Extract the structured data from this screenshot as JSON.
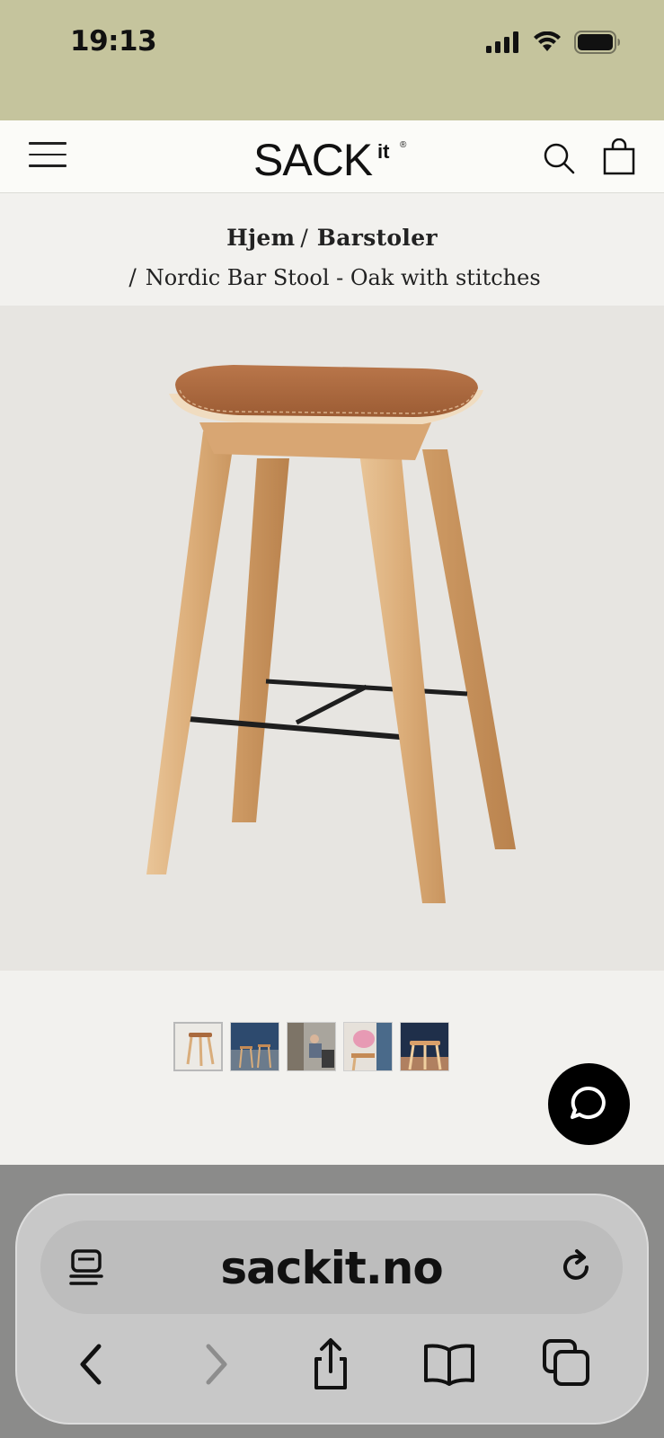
{
  "status_bar": {
    "time": "19:13",
    "icons": [
      "signal-icon",
      "wifi-icon",
      "battery-icon"
    ]
  },
  "header": {
    "logo_text": "SACK",
    "logo_suffix": "it",
    "logo_mark": "®",
    "icons": [
      "menu-icon",
      "search-icon",
      "shopping-bag-icon"
    ]
  },
  "breadcrumb": {
    "home": "Hjem",
    "category": "Barstoler",
    "separator": "/",
    "current": "Nordic Bar Stool - Oak with stitches"
  },
  "product": {
    "image_alt": "Nordic Bar Stool - Oak with stitches",
    "thumbnails": [
      "stool-front",
      "kitchen-scene-1",
      "people-scene",
      "pink-detail",
      "dark-kitchen-scene"
    ],
    "active_thumbnail": 1
  },
  "chat": {
    "icon": "chat-bubble-icon"
  },
  "browser": {
    "url": "sackit.no",
    "icons": [
      "reader-icon",
      "reload-icon",
      "back-icon",
      "forward-icon",
      "share-icon",
      "bookmarks-icon",
      "tabs-icon"
    ]
  },
  "colors": {
    "status_bar_bg": "#c5c49d",
    "page_bg": "#f2f1ee",
    "product_bg": "#e7e5e1",
    "accent_black": "#000000"
  }
}
